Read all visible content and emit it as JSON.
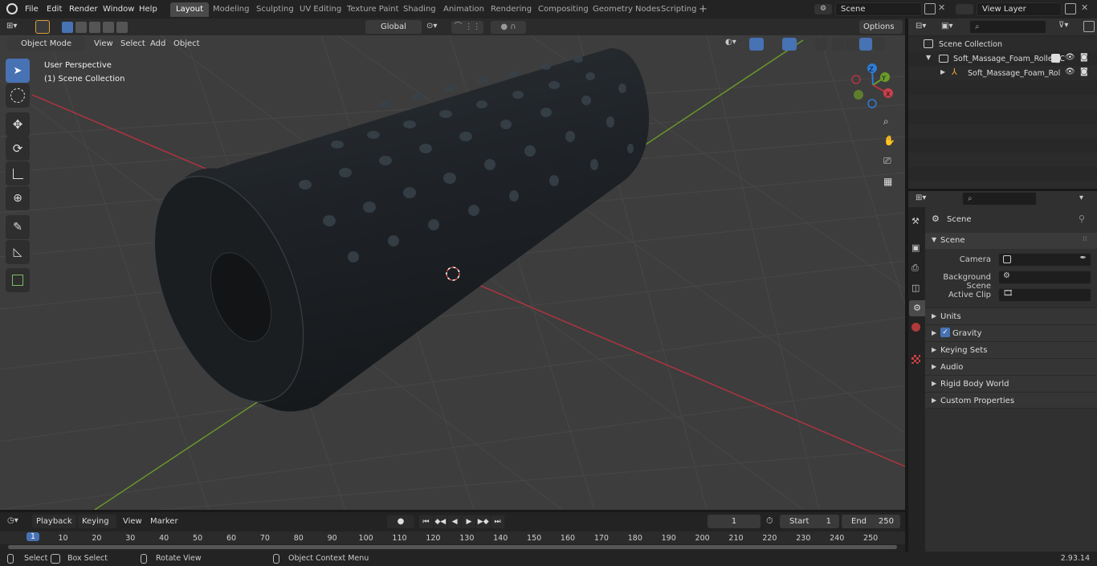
{
  "menu": [
    "File",
    "Edit",
    "Render",
    "Window",
    "Help"
  ],
  "workspaces": [
    "Layout",
    "Modeling",
    "Sculpting",
    "UV Editing",
    "Texture Paint",
    "Shading",
    "Animation",
    "Rendering",
    "Compositing",
    "Geometry Nodes",
    "Scripting"
  ],
  "active_workspace": "Layout",
  "scene_field": "Scene",
  "view_layer_field": "View Layer",
  "header": {
    "mode": "Object Mode",
    "menus": [
      "View",
      "Select",
      "Add",
      "Object"
    ],
    "transform": "Global",
    "options": "Options"
  },
  "viewport": {
    "perspective": "User Perspective",
    "collection": "(1) Scene Collection",
    "gizmo": {
      "z": "Z",
      "y": "Y",
      "x": "X"
    }
  },
  "outliner": {
    "root": "Scene Collection",
    "items": [
      "Soft_Massage_Foam_Roller_C",
      "Soft_Massage_Foam_Rol"
    ]
  },
  "properties": {
    "header": "Scene",
    "section": "Scene",
    "fields": [
      {
        "label": "Camera"
      },
      {
        "label": "Background Scene"
      },
      {
        "label": "Active Clip"
      }
    ],
    "panels": [
      "Units",
      "Gravity",
      "Keying Sets",
      "Audio",
      "Rigid Body World",
      "Custom Properties"
    ],
    "gravity_checked": true
  },
  "timeline": {
    "menus": [
      "Playback",
      "Keying",
      "View",
      "Marker"
    ],
    "current_frame": "1",
    "start_label": "Start",
    "start": "1",
    "end_label": "End",
    "end": "250",
    "ruler": [
      "1",
      "10",
      "20",
      "30",
      "40",
      "50",
      "60",
      "70",
      "80",
      "90",
      "100",
      "110",
      "120",
      "130",
      "140",
      "150",
      "160",
      "170",
      "180",
      "190",
      "200",
      "210",
      "220",
      "230",
      "240",
      "250"
    ]
  },
  "status": {
    "select": "Select",
    "box_select": "Box Select",
    "rotate_view": "Rotate View",
    "context_menu": "Object Context Menu",
    "version": "2.93.14"
  },
  "colors": {
    "accent": "#4772b3",
    "x_axis": "#b5343f",
    "y_axis": "#6b9a2a",
    "z_axis": "#2e7cd5"
  }
}
